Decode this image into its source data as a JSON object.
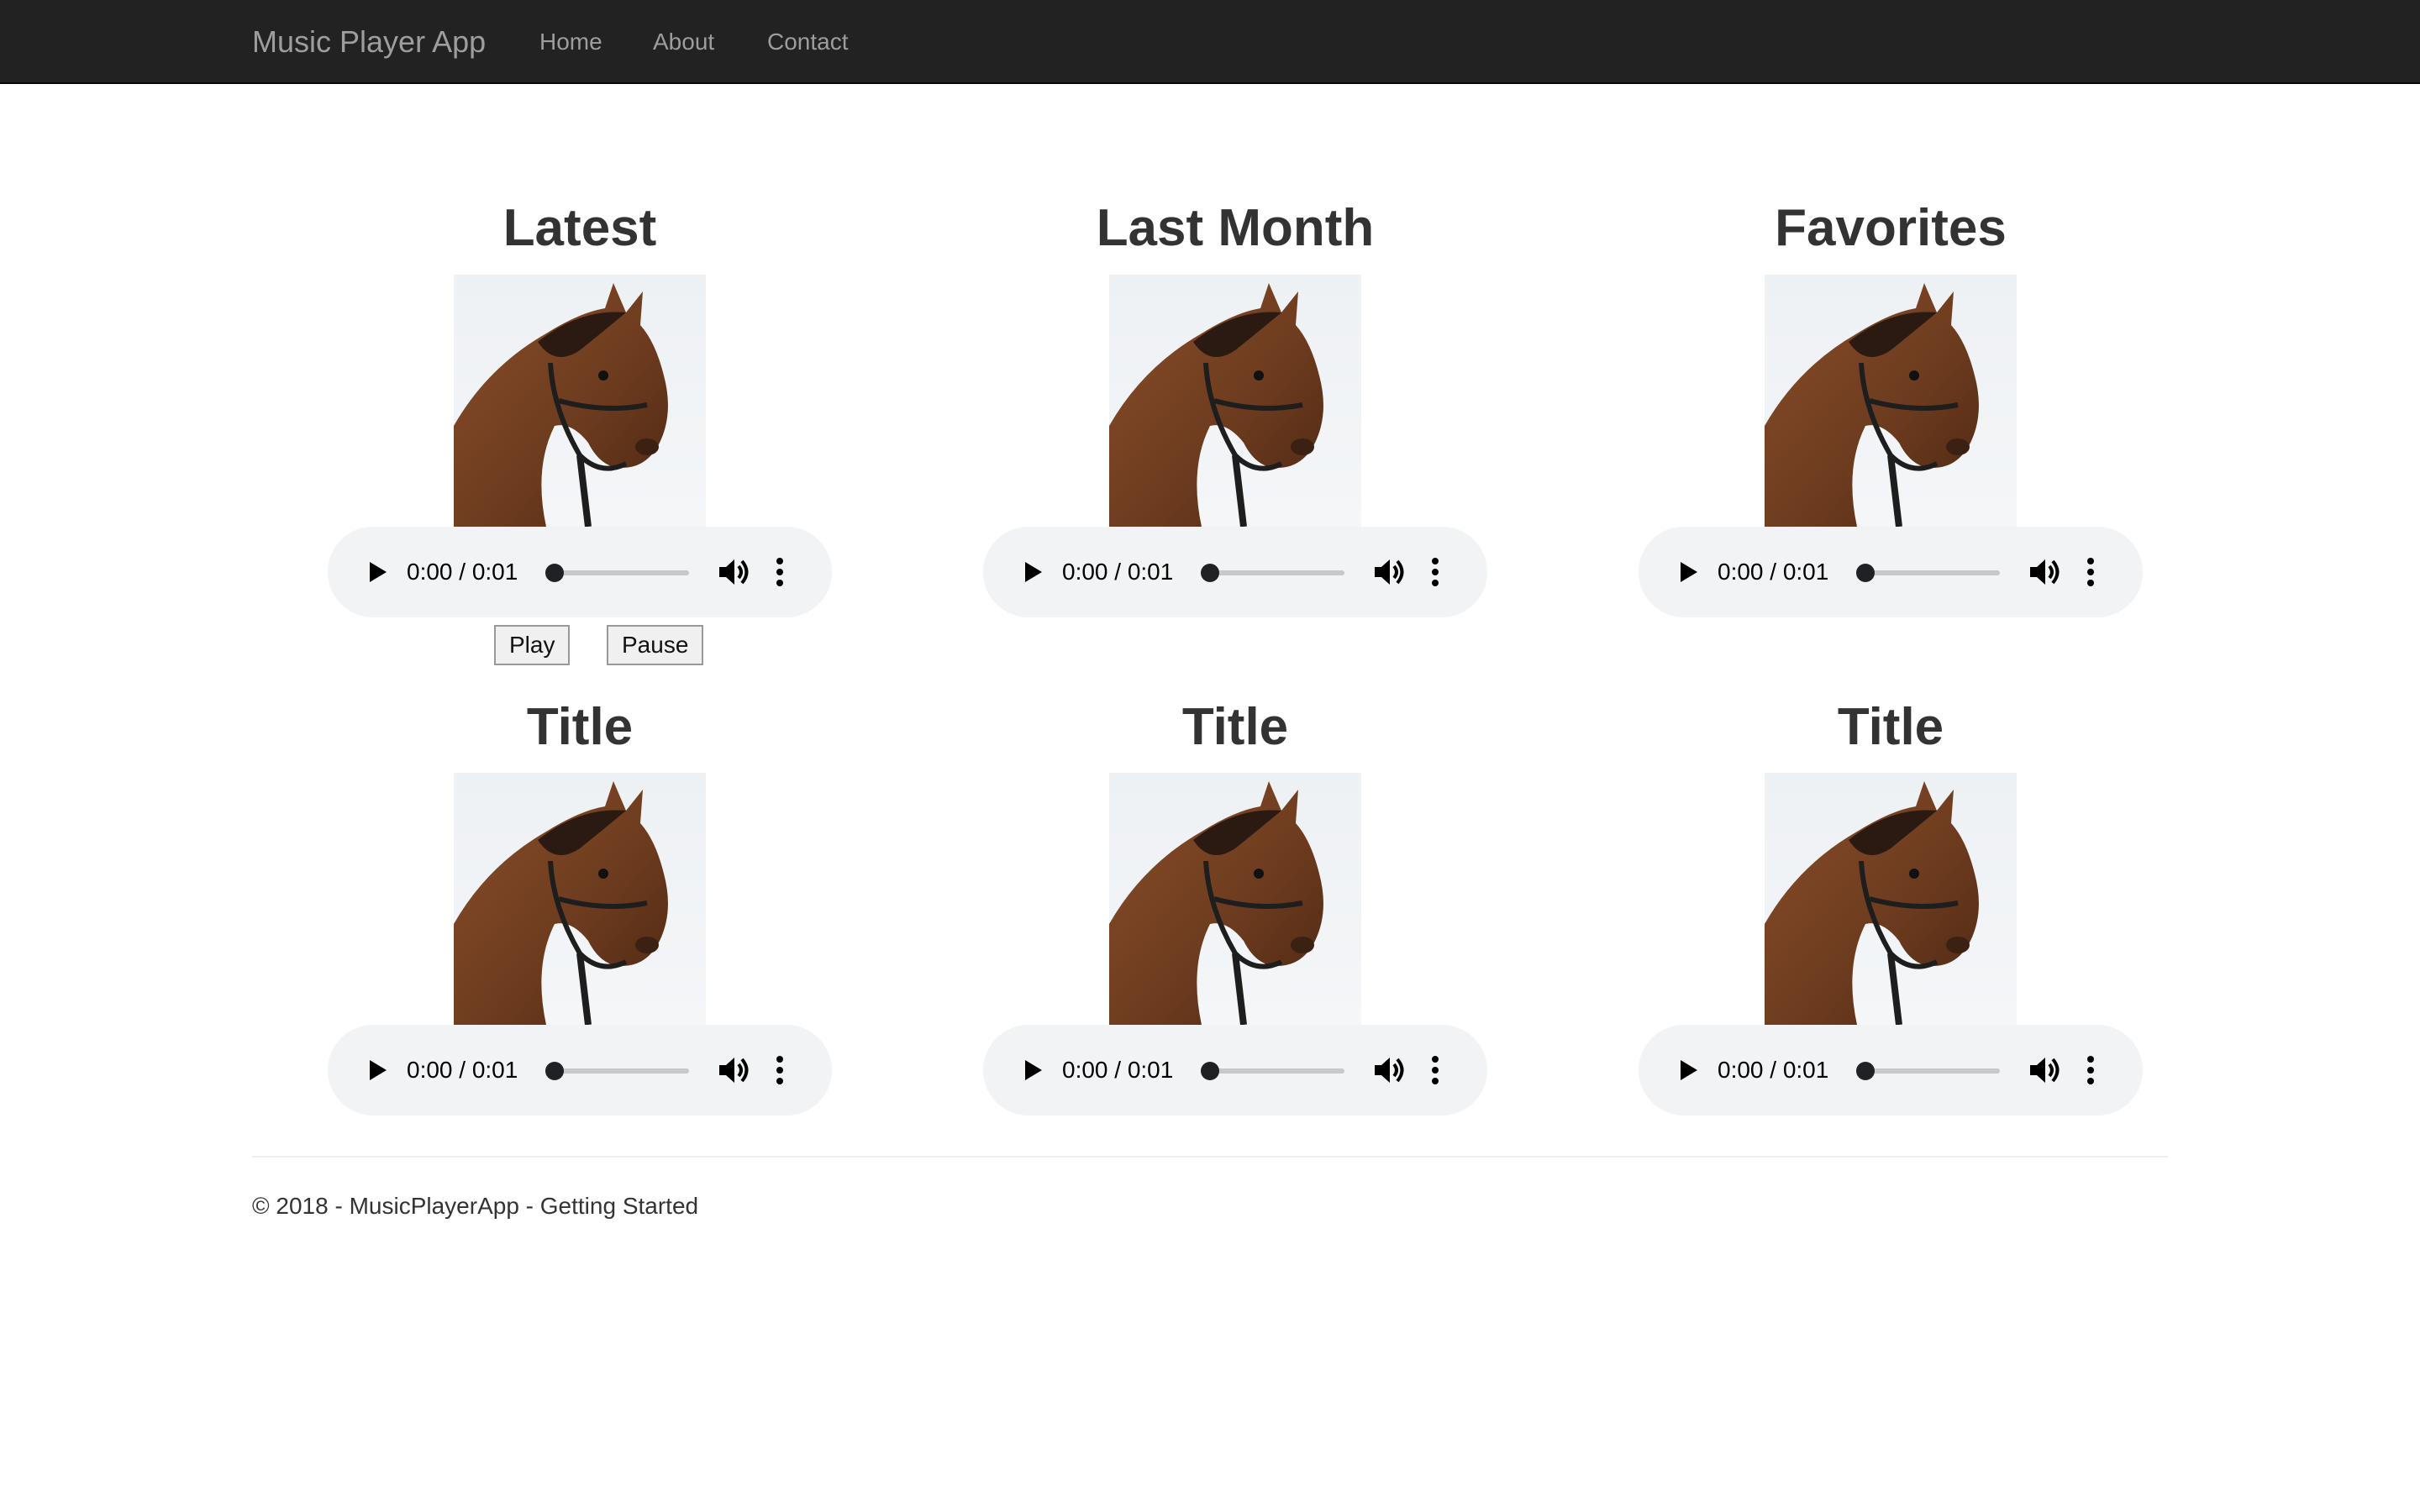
{
  "navbar": {
    "brand": "Music Player App",
    "links": [
      "Home",
      "About",
      "Contact"
    ]
  },
  "cards": [
    {
      "title": "Latest",
      "art": "horse-image",
      "player": {
        "time": "0:00 / 0:01",
        "progress": 0
      }
    },
    {
      "title": "Last Month",
      "art": "horse-image",
      "player": {
        "time": "0:00 / 0:01",
        "progress": 0
      }
    },
    {
      "title": "Favorites",
      "art": "horse-image",
      "player": {
        "time": "0:00 / 0:01",
        "progress": 0
      }
    },
    {
      "title": "Title",
      "art": "horse-image",
      "player": {
        "time": "0:00 / 0:01",
        "progress": 0
      }
    },
    {
      "title": "Title",
      "art": "horse-image",
      "player": {
        "time": "0:00 / 0:01",
        "progress": 0
      }
    },
    {
      "title": "Title",
      "art": "horse-image",
      "player": {
        "time": "0:00 / 0:01",
        "progress": 0
      }
    }
  ],
  "controls": {
    "play_label": "Play",
    "pause_label": "Pause"
  },
  "footer": {
    "text": "© 2018 - MusicPlayerApp - Getting Started"
  },
  "colors": {
    "navbar_bg": "#222222",
    "nav_text": "#9d9d9d",
    "player_bg": "#f1f3f4"
  }
}
